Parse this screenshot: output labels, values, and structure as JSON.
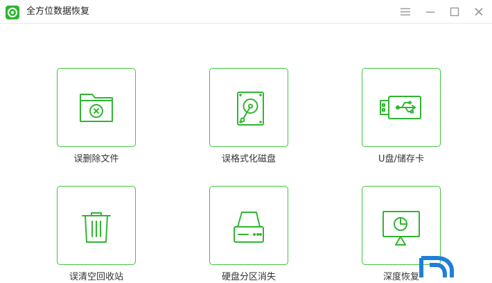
{
  "window": {
    "title": "全方位数据恢复",
    "accent_color": "#3cc43c",
    "logo_icon": "recovery-logo-icon"
  },
  "titlebar_buttons": [
    {
      "name": "menu",
      "icon": "hamburger-menu-icon"
    },
    {
      "name": "minimize",
      "icon": "minimize-icon"
    },
    {
      "name": "maximize",
      "icon": "maximize-icon"
    },
    {
      "name": "close",
      "icon": "close-icon"
    }
  ],
  "tiles": [
    {
      "label": "误删除文件",
      "icon": "folder-delete-icon"
    },
    {
      "label": "误格式化磁盘",
      "icon": "hard-disk-icon"
    },
    {
      "label": "U盘/储存卡",
      "icon": "usb-drive-icon"
    },
    {
      "label": "误清空回收站",
      "icon": "recycle-bin-icon"
    },
    {
      "label": "硬盘分区消失",
      "icon": "disk-partition-icon"
    },
    {
      "label": "深度恢复",
      "icon": "deep-recovery-icon"
    }
  ]
}
